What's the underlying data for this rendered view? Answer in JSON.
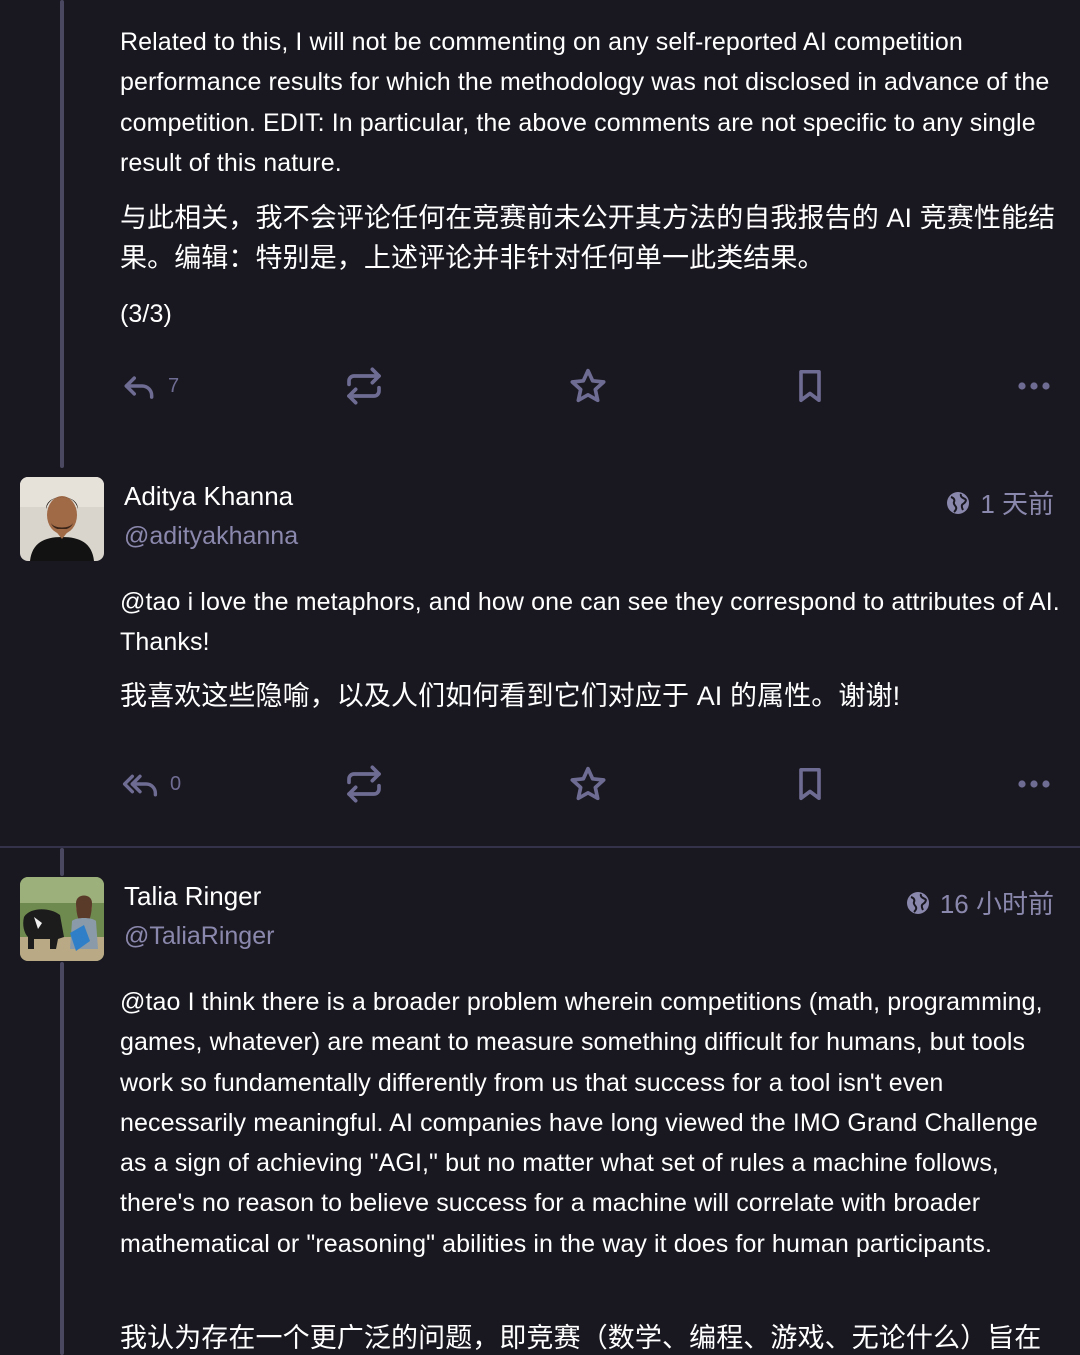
{
  "posts": [
    {
      "paragraphs": [
        "Related to this, I will not be commenting on any self-reported AI competition performance results for which the methodology was not disclosed in advance of the competition. EDIT: In particular, the above comments are not specific to any single result of this nature.",
        "与此相关，我不会评论任何在竞赛前未公开其方法的自我报告的 AI 竞赛性能结果。编辑：特别是，上述评论并非针对任何单一此类结果。",
        "(3/3)"
      ],
      "actions": {
        "reply_icon": "reply-icon",
        "reply_count": "7",
        "boost_icon": "boost-icon",
        "favourite_icon": "star-icon",
        "bookmark_icon": "bookmark-icon",
        "more_icon": "more-icon"
      }
    },
    {
      "display_name": "Aditya Khanna",
      "handle": "@adityakhanna",
      "time": "1 天前",
      "visibility_icon": "globe-icon",
      "mention": "@tao",
      "paragraphs": [
        " i love the metaphors, and how one can see they correspond to attributes of AI. Thanks!",
        "我喜欢这些隐喻，以及人们如何看到它们对应于 AI 的属性。谢谢!"
      ],
      "actions": {
        "reply_icon": "reply-all-icon",
        "reply_count": "0",
        "boost_icon": "boost-icon",
        "favourite_icon": "star-icon",
        "bookmark_icon": "bookmark-icon",
        "more_icon": "more-icon"
      }
    },
    {
      "display_name": "Talia Ringer",
      "handle": "@TaliaRinger",
      "time": "16 小时前",
      "visibility_icon": "globe-icon",
      "mention": "@tao",
      "paragraphs": [
        " I think there is a broader problem wherein competitions (math, programming, games, whatever) are meant to measure something difficult for humans, but tools work so fundamentally differently from us that success for a tool isn't even necessarily meaningful. AI companies have long viewed the IMO Grand Challenge as a sign of achieving \"AGI,\" but no matter what set of rules a machine follows, there's no reason to believe success for a machine will correlate with broader mathematical or \"reasoning\" abilities in the way it does for human participants.",
        "我认为存在一个更广泛的问题，即竞赛（数学、编程、游戏、无论什么）旨在"
      ]
    }
  ],
  "colors": {
    "background": "#191820",
    "thread_line": "#4a4860",
    "muted_text": "#8b88ad",
    "icon": "#6f6c93",
    "divider": "#34324a"
  }
}
